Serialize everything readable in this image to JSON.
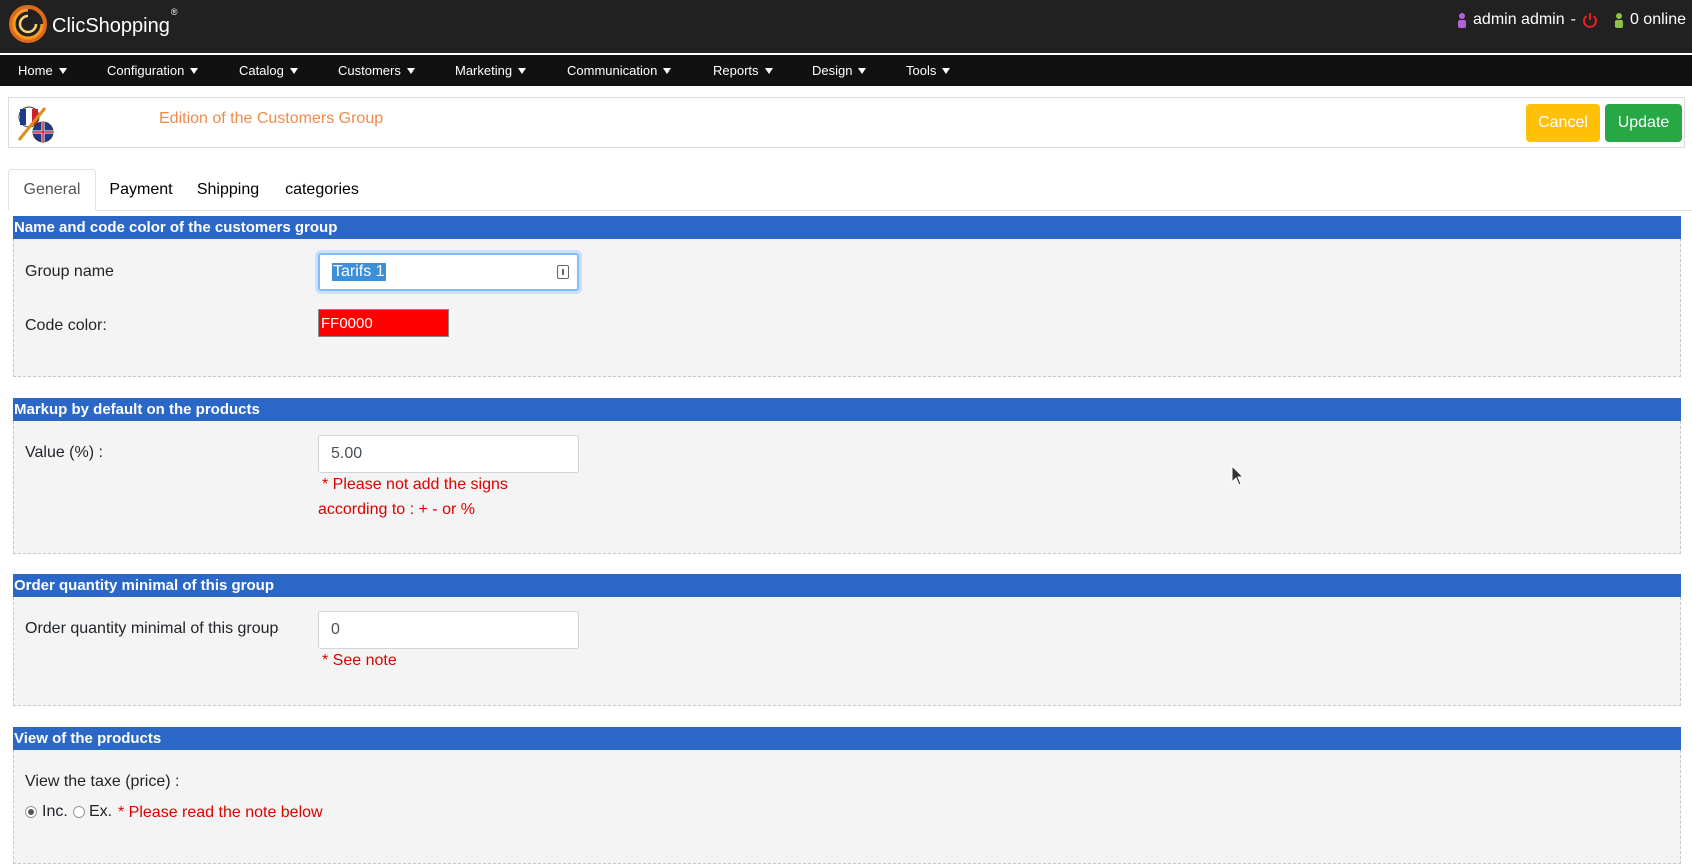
{
  "app": {
    "brand": "ClicShopping",
    "brand_mark": "®",
    "user": "admin admin",
    "separator": "-",
    "online": "0 online"
  },
  "nav": {
    "items": [
      "Home",
      "Configuration",
      "Catalog",
      "Customers",
      "Marketing",
      "Communication",
      "Reports",
      "Design",
      "Tools"
    ]
  },
  "header": {
    "title": "Edition of the Customers Group",
    "cancel_label": "Cancel",
    "update_label": "Update"
  },
  "tabs": [
    "General",
    "Payment",
    "Shipping",
    "categories"
  ],
  "sections": {
    "name_color": {
      "title": "Name and code color of the customers group",
      "group_name_label": "Group name",
      "group_name_value": "Tarifs 1",
      "code_color_label": "Code color:",
      "code_color_value": "FF0000"
    },
    "markup": {
      "title": "Markup by default on the products",
      "value_label": "Value (%) :",
      "value": "5.00",
      "note_line1": "* Please not add the signs",
      "note_line2": "according to : + - or %"
    },
    "order_qty": {
      "title": "Order quantity minimal of this group",
      "label": "Order quantity minimal of this group",
      "value": "0",
      "note": "* See note"
    },
    "view_products": {
      "title": "View of the products",
      "tax_label": "View the taxe (price) :",
      "inc_label": "Inc.",
      "ex_label": "Ex.",
      "note": "* Please read the note below"
    }
  },
  "colors": {
    "topbar": "#212121",
    "section_header": "#2b67c6",
    "cancel": "#ffc107",
    "update": "#28a745",
    "header_title": "#f08a4b",
    "code_color": "#FF0000",
    "note": "#e00000"
  }
}
